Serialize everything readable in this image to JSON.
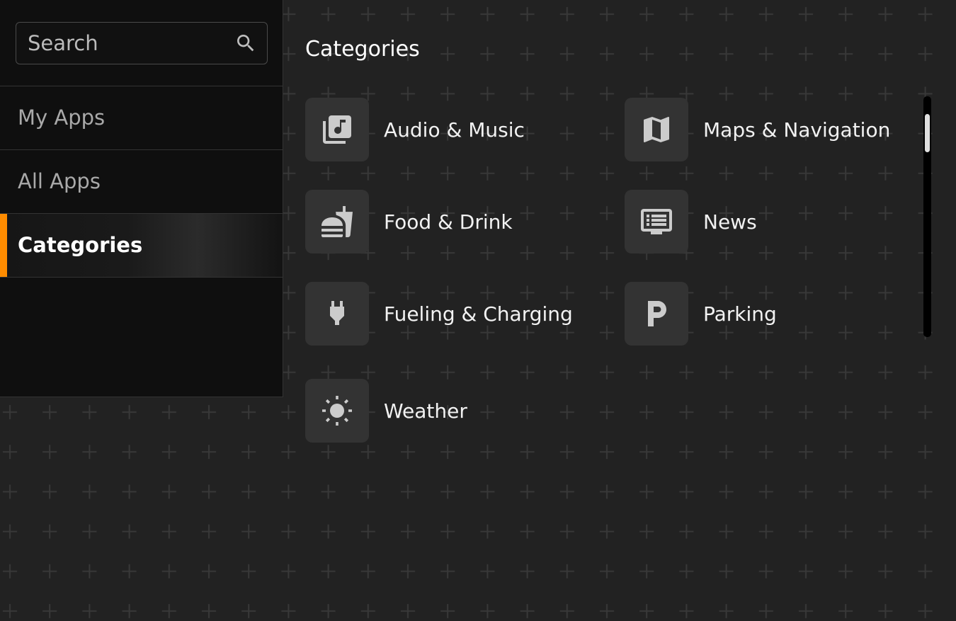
{
  "search": {
    "placeholder": "Search"
  },
  "nav": {
    "items": [
      {
        "label": "My Apps"
      },
      {
        "label": "All Apps"
      },
      {
        "label": "Categories"
      }
    ]
  },
  "main": {
    "title": "Categories",
    "categories": [
      {
        "label": "Audio & Music",
        "icon": "music-library-icon"
      },
      {
        "label": "Maps & Navigation",
        "icon": "map-icon"
      },
      {
        "label": "Food & Drink",
        "icon": "fastfood-icon"
      },
      {
        "label": "News",
        "icon": "news-icon"
      },
      {
        "label": "Fueling & Charging",
        "icon": "power-plug-icon"
      },
      {
        "label": "Parking",
        "icon": "parking-icon"
      },
      {
        "label": "Weather",
        "icon": "sun-icon"
      }
    ]
  },
  "colors": {
    "accent": "#ff8c00",
    "background": "#222222",
    "sidebar": "#0f0f0f",
    "tile": "#333333",
    "icon": "#cccccc"
  }
}
